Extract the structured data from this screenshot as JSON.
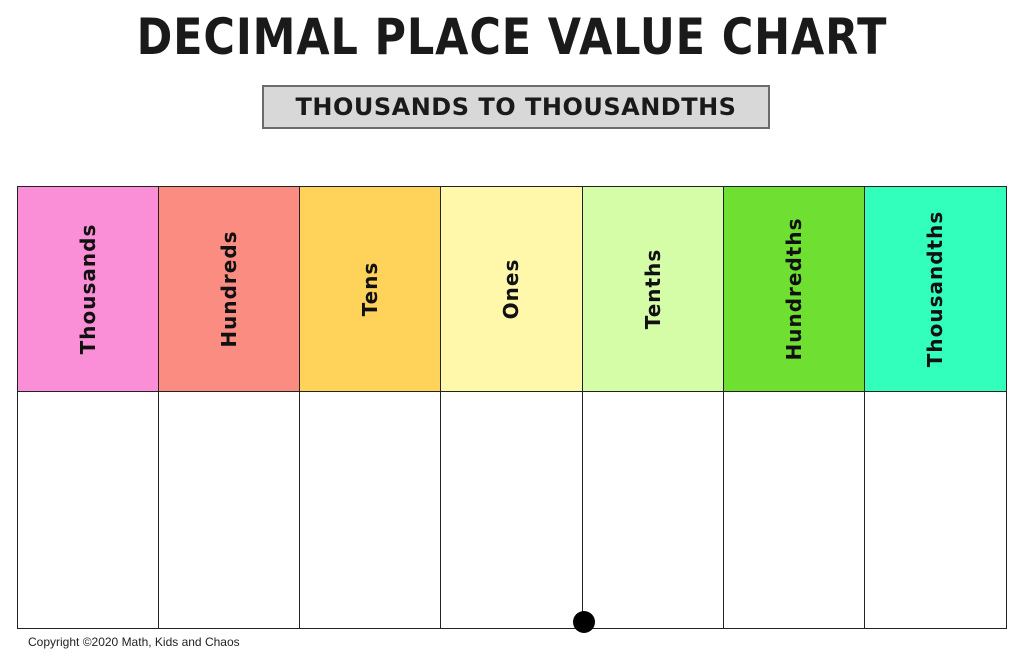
{
  "title": "DECIMAL PLACE VALUE CHART",
  "subtitle": "THOUSANDS TO THOUSANDTHS",
  "columns": [
    {
      "label": "Thousands",
      "color": "#fa8fd8"
    },
    {
      "label": "Hundreds",
      "color": "#fa8c82"
    },
    {
      "label": "Tens",
      "color": "#ffd35a"
    },
    {
      "label": "Ones",
      "color": "#fff8ab"
    },
    {
      "label": "Tenths",
      "color": "#d5fca6"
    },
    {
      "label": "Hundredths",
      "color": "#6fe032"
    },
    {
      "label": "Thousandths",
      "color": "#32ffbb"
    }
  ],
  "copyright": "Copyright ©2020 Math, Kids and Chaos"
}
